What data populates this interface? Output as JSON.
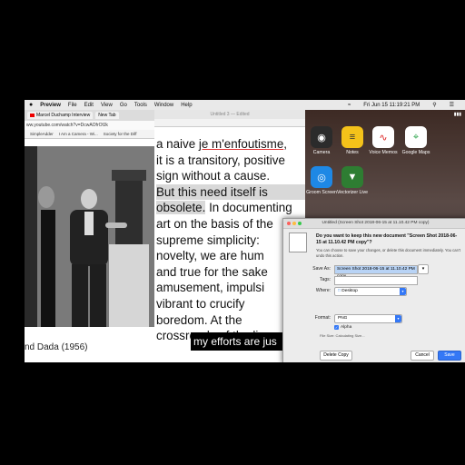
{
  "menubar": {
    "apple": "",
    "app_name": "Preview",
    "items": [
      "File",
      "Edit",
      "View",
      "Go",
      "Tools",
      "Window",
      "Help"
    ],
    "clock": "Fri Jun 15  11:19:21 PM"
  },
  "browser": {
    "tab1": "Marcel Duchamp Interview",
    "tab2": "New Tab",
    "url": "ww.youtube.com/watch?v=DcwAOfrOfJk",
    "bookmarks": [
      "SimpleAdder",
      "I Am a Camera - Wi...",
      "Society for the Diff"
    ],
    "caption": "nd Dada (1956)"
  },
  "editor": {
    "title": "Untitled 3 — Edited",
    "lines": [
      "a naive je m'enfoutisme,",
      "it is a transitory, positive",
      "sign without a cause.",
      "But this need itself is",
      "obsolete. In documenting",
      "art on the basis of the",
      "supreme simplicity:",
      "novelty, we are hum",
      "and true for the sake",
      "amusement, impulsi",
      "vibrant to crucify",
      "boredom. At the",
      "crossroads of the lig"
    ],
    "subtitle": "my efforts are jus"
  },
  "phone": {
    "apps": [
      {
        "label": "Camera",
        "icon": "camera-icon",
        "glyph": "◉",
        "color": "#2b2b2b"
      },
      {
        "label": "Notes",
        "icon": "notes-icon",
        "glyph": "≡",
        "color": "#f4c21a"
      },
      {
        "label": "Voice Memos",
        "icon": "voice-memos-icon",
        "glyph": "∿",
        "color": "#ffffff"
      },
      {
        "label": "Google Maps",
        "icon": "google-maps-icon",
        "glyph": "⌖",
        "color": "#34a853"
      },
      {
        "label": "Groom Screen",
        "icon": "groom-screen-icon",
        "glyph": "◎",
        "color": "#1e88e5"
      },
      {
        "label": "Vectorizer Live",
        "icon": "vectorizer-live-icon",
        "glyph": "▼",
        "color": "#2e7d32"
      }
    ]
  },
  "dialog": {
    "title": "Untitled (Screen Shot 2018-06-15 at 11.10.42 PM copy)",
    "question": "Do you want to keep this new document \"Screen Shot 2018-06-15 at 11.10.42 PM copy\"?",
    "sub": "You can choose to save your changes, or delete this document immediately. You can't undo this action.",
    "save_as_label": "Save As:",
    "save_as_value": "Screen Shot 2018-06-15 at 11.10.42 PM copy",
    "tags_label": "Tags:",
    "where_label": "Where:",
    "where_value": "Desktop",
    "format_label": "Format:",
    "format_value": "PNG",
    "alpha_label": "Alpha",
    "file_size": "File Size: Calculating Size...",
    "delete_label": "Delete Copy",
    "cancel_label": "Cancel",
    "save_label": "Save"
  }
}
